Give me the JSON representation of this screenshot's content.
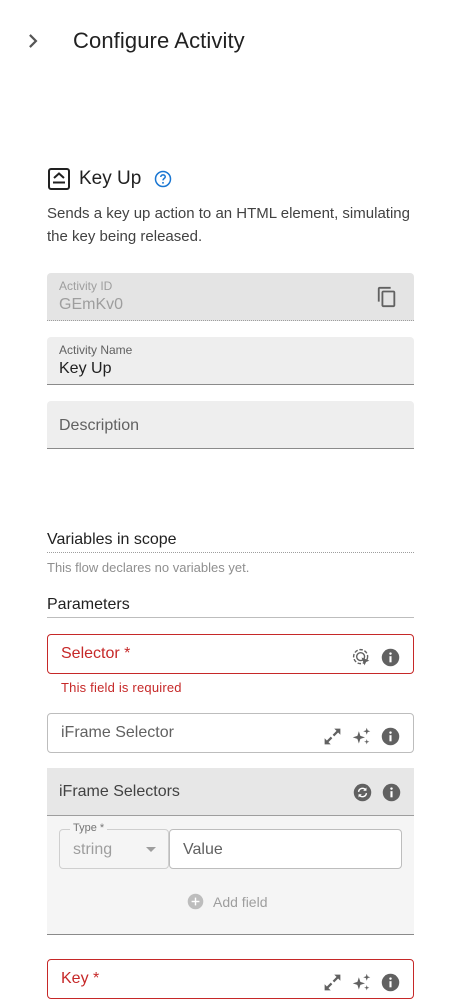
{
  "header": {
    "title": "Configure Activity"
  },
  "activity": {
    "title": "Key Up",
    "description": "Sends a key up action to an HTML element, simulating the key being released."
  },
  "fields": {
    "activity_id": {
      "label": "Activity ID",
      "value": "GEmKv0"
    },
    "activity_name": {
      "label": "Activity Name",
      "value": "Key Up"
    },
    "description": {
      "placeholder": "Description"
    }
  },
  "variables": {
    "title": "Variables in scope",
    "note": "This flow declares no variables yet."
  },
  "parameters": {
    "title": "Parameters",
    "selector": {
      "label": "Selector *",
      "error": "This field is required"
    },
    "iframe_selector": {
      "label": "iFrame Selector"
    },
    "iframe_selectors": {
      "title": "iFrame Selectors",
      "type_label": "Type *",
      "type_value": "string",
      "value_placeholder": "Value",
      "add_field": "Add field"
    },
    "key": {
      "label": "Key *"
    }
  },
  "colors": {
    "error": "#c62828",
    "accent": "#1976d2",
    "icon": "#616161"
  }
}
